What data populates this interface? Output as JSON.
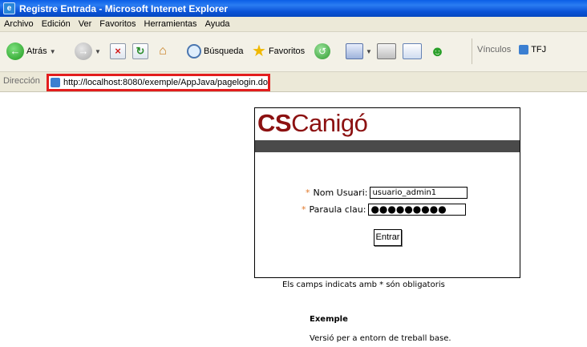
{
  "window": {
    "title": "Registre Entrada - Microsoft Internet Explorer"
  },
  "menu": [
    "Archivo",
    "Edición",
    "Ver",
    "Favoritos",
    "Herramientas",
    "Ayuda"
  ],
  "toolbar": {
    "back_label": "Atrás",
    "search_label": "Búsqueda",
    "favorites_label": "Favoritos",
    "links_label": "Vínculos",
    "links_item": "TFJ"
  },
  "address": {
    "label": "Dirección",
    "url": "http://localhost:8080/exemple/AppJava/pagelogin.do"
  },
  "brand": {
    "prefix": "CS",
    "name": "Canigó"
  },
  "form": {
    "required_mark": "*",
    "user_label": "Nom Usuari:",
    "user_value": "usuario_admin1",
    "password_label": "Paraula clau:",
    "password_value": "●●●●●●●●●",
    "submit_label": "Entrar"
  },
  "required_note": "Els camps indicats amb * són obligatoris",
  "example": {
    "title": "Exemple",
    "description": "Versió per a entorn de treball base."
  },
  "colors": {
    "brand": "#8c1111",
    "required": "#e0782a",
    "highlight": "#e31d1d"
  }
}
